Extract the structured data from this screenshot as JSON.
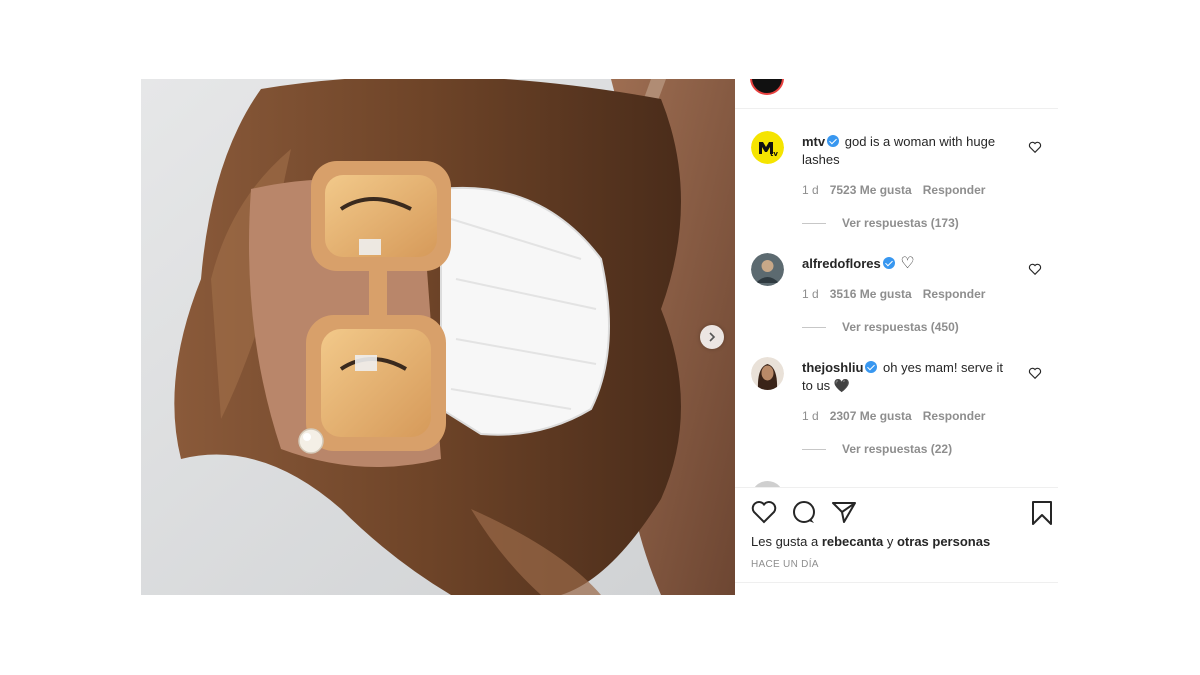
{
  "post": {
    "image": {
      "description_icon": "photo",
      "next_icon": "chevron-right-icon"
    },
    "likes": {
      "prefix": "Les gusta a ",
      "user": "rebecanta",
      "joiner": " y ",
      "others": "otras personas"
    },
    "timestamp": "HACE UN DÍA"
  },
  "comments": [
    {
      "user": "mtv",
      "verified": true,
      "text": "god is a woman with huge lashes",
      "time": "1 d",
      "likes": "7523 Me gusta",
      "reply": "Responder",
      "replies": "Ver respuestas (173)",
      "avatar_color": "#f5e400"
    },
    {
      "user": "alfredoflores",
      "verified": true,
      "text": "♡",
      "time": "1 d",
      "likes": "3516 Me gusta",
      "reply": "Responder",
      "replies": "Ver respuestas (450)",
      "avatar_color": "#5c6a70"
    },
    {
      "user": "thejoshliu",
      "verified": true,
      "text": "oh yes mam! serve it to us 🖤",
      "time": "1 d",
      "likes": "2307 Me gusta",
      "reply": "Responder",
      "replies": "Ver respuestas (22)",
      "avatar_color": "#6b4a3a"
    }
  ],
  "colors": {
    "verified": "#3897f0",
    "meta_text": "#8e8e8e",
    "divider": "#efefef"
  }
}
